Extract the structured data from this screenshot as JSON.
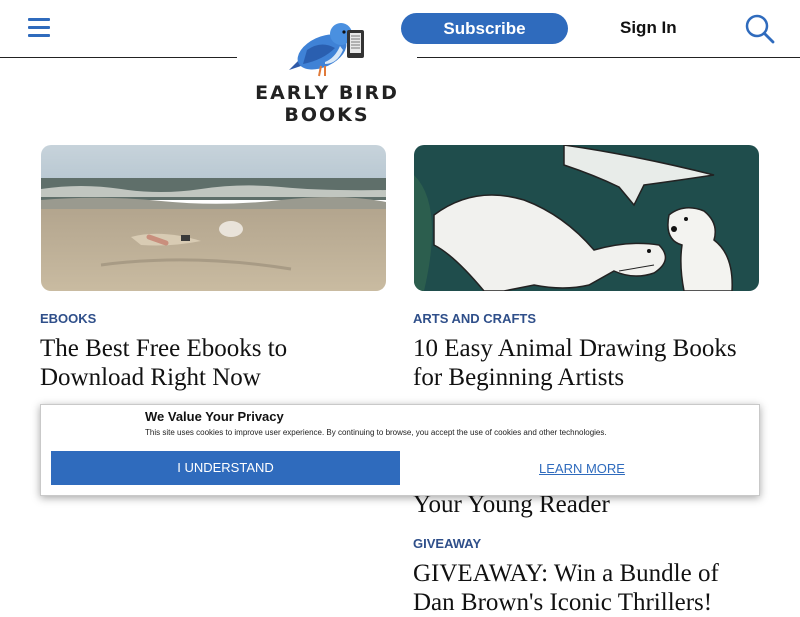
{
  "header": {
    "logo_text": "EARLY BIRD BOOKS",
    "subscribe_label": "Subscribe",
    "signin_label": "Sign In"
  },
  "articles": [
    {
      "category": "EBOOKS",
      "title": "The Best Free Ebooks to Download Right Now"
    },
    {
      "category": "ARTS AND CRAFTS",
      "title": "10 Easy Animal Drawing Books for Beginning Artists"
    },
    {
      "category": "",
      "title": "Your Young Reader"
    },
    {
      "category": "GIVEAWAY",
      "title": "GIVEAWAY: Win a Bundle of Dan Brown's Iconic Thrillers!"
    }
  ],
  "privacy": {
    "title": "We Value Your Privacy",
    "text": "This site uses cookies to improve user experience. By continuing to browse, you accept the use of cookies and other technologies.",
    "accept_label": "I UNDERSTAND",
    "learn_label": "LEARN MORE"
  },
  "colors": {
    "accent": "#2f6bbd",
    "category": "#2f4f8a"
  }
}
